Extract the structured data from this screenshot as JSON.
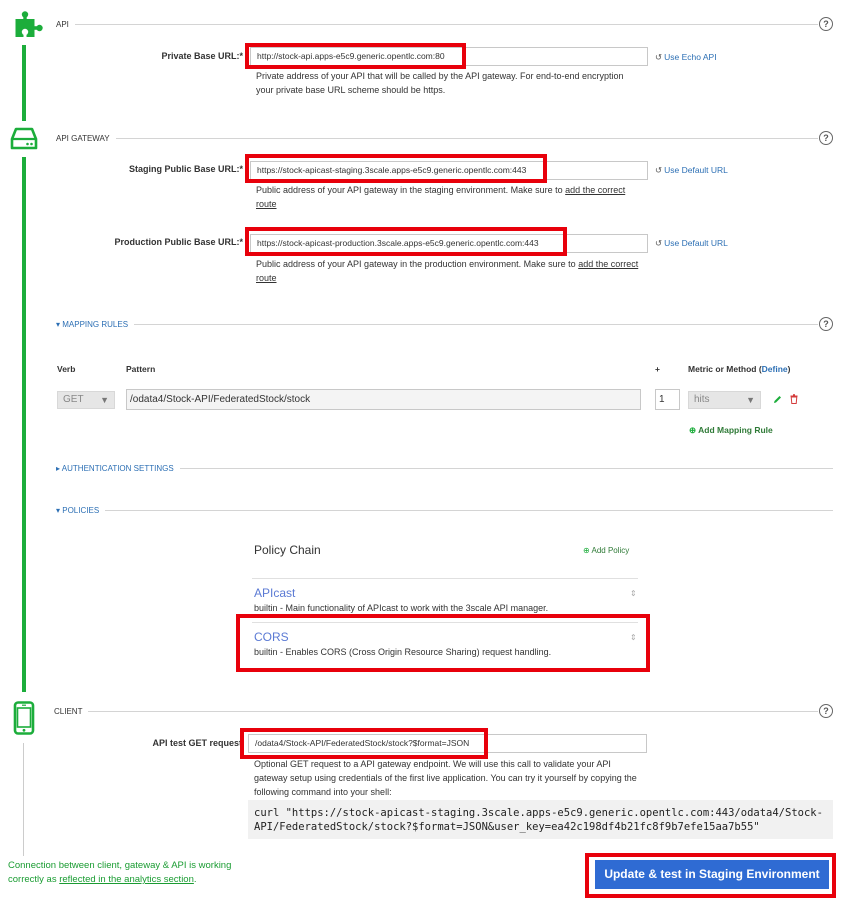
{
  "api": {
    "section_label": "API",
    "private_base_url_label": "Private Base URL:",
    "required_mark": "*",
    "private_base_url_value": "http://stock-api.apps-e5c9.generic.opentlc.com:80",
    "use_echo_api": "Use Echo API",
    "hint": "Private address of your API that will be called by the API gateway. For end-to-end encryption your private base URL scheme should be https."
  },
  "gateway": {
    "section_label": "API GATEWAY",
    "staging_label": "Staging Public Base URL:",
    "staging_value": "https://stock-apicast-staging.3scale.apps-e5c9.generic.opentlc.com:443",
    "staging_hint_pre": "Public address of your API gateway in the staging environment. Make sure to ",
    "add_route_link": "add the correct route",
    "use_default_url": "Use Default URL",
    "production_label": "Production Public Base URL:",
    "production_value": "https://stock-apicast-production.3scale.apps-e5c9.generic.opentlc.com:443",
    "production_hint_pre": "Public address of your API gateway in the production environment. Make sure to "
  },
  "mapping": {
    "section_label": "MAPPING RULES",
    "col_verb": "Verb",
    "col_pattern": "Pattern",
    "col_plus": "+",
    "col_metric": "Metric or Method (",
    "define_link": "Define",
    "col_metric_close": ")",
    "row": {
      "verb": "GET",
      "pattern": "/odata4/Stock-API/FederatedStock/stock",
      "delta": "1",
      "metric": "hits"
    },
    "add_rule": "Add Mapping Rule"
  },
  "auth": {
    "section_label": "AUTHENTICATION SETTINGS"
  },
  "policies": {
    "section_label": "POLICIES",
    "chain_title": "Policy Chain",
    "add_policy": "Add Policy",
    "items": [
      {
        "name": "APIcast",
        "desc": "builtin - Main functionality of APIcast to work with the 3scale API manager."
      },
      {
        "name": "CORS",
        "desc": "builtin - Enables CORS (Cross Origin Resource Sharing) request handling."
      }
    ]
  },
  "client": {
    "section_label": "CLIENT",
    "test_label": "API test GET request",
    "test_value": "/odata4/Stock-API/FederatedStock/stock?$format=JSON",
    "hint": "Optional GET request to a API gateway endpoint. We will use this call to validate your API gateway setup using credentials of the first live application. You can try it yourself by copying the following command into your shell:",
    "curl": "curl \"https://stock-apicast-staging.3scale.apps-e5c9.generic.opentlc.com:443/odata4/Stock-API/FederatedStock/stock?$format=JSON&user_key=ea42c198df4b21fc8f9b7efe15aa7b55\""
  },
  "footer": {
    "conn_pre": "Connection between client, gateway & API is working correctly as ",
    "conn_link": "reflected in the analytics section",
    "conn_post": ".",
    "update_button": "Update & test in Staging Environment"
  },
  "help_glyph": "?",
  "colors": {
    "accent_green": "#1cad3b",
    "highlight_red": "#e8000b",
    "primary_button": "#2f6bd3",
    "link_blue": "#2c6fb4"
  }
}
